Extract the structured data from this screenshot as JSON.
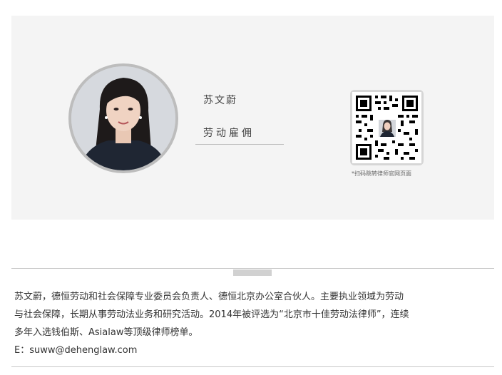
{
  "profile": {
    "name": "苏文蔚",
    "department": "劳动雇佣",
    "qr_caption": "*扫码跳转律师官网页面"
  },
  "bio": {
    "lines": [
      "苏文蔚，德恒劳动和社会保障专业委员会负责人、德恒北京办公室合伙人。主要执业领域为劳动",
      "与社会保障，长期从事劳动法业务和研究活动。2014年被评选为“北京市十佳劳动法律师”，连续",
      "多年入选钱伯斯、Asialaw等顶级律师榜单。",
      "E：suww@dehenglaw.com"
    ]
  },
  "colors": {
    "card_background": "#f4f4f4",
    "divider": "#c8c8c8",
    "text": "#333333"
  }
}
